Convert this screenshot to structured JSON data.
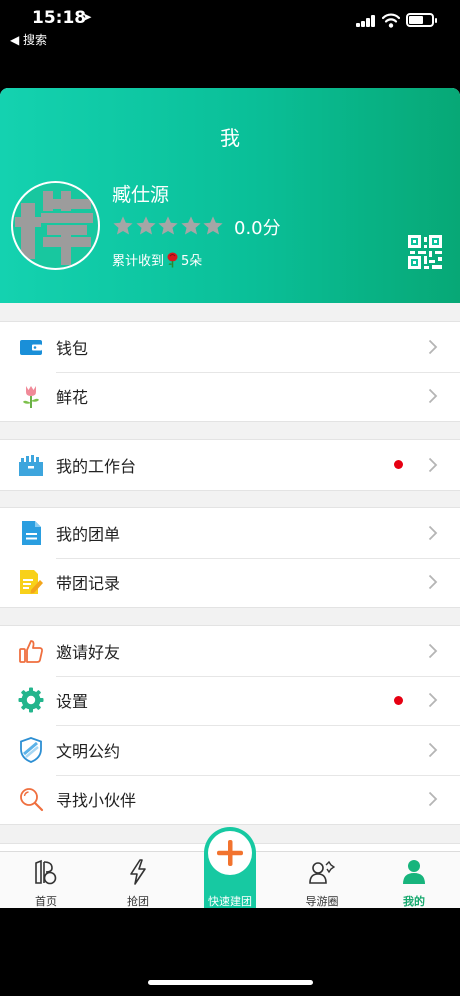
{
  "status_bar": {
    "time": "15:18",
    "back_label": "◀ 搜索"
  },
  "header": {
    "title": "我",
    "avatar_icon": "avatar-placeholder-icon",
    "user_name": "臧仕源",
    "rating": "0.0分",
    "flowers_prefix": "累计收到",
    "flowers_count": "5朵",
    "qr_icon": "qr-code-icon"
  },
  "menu": {
    "wallet": {
      "label": "钱包",
      "icon": "wallet-icon"
    },
    "flowers": {
      "label": "鲜花",
      "icon": "flower-icon"
    },
    "workbench": {
      "label": "我的工作台",
      "icon": "workbench-icon"
    },
    "my_group_orders": {
      "label": "我的团单",
      "icon": "document-icon"
    },
    "tour_records": {
      "label": "带团记录",
      "icon": "edit-note-icon"
    },
    "invite_friends": {
      "label": "邀请好友",
      "icon": "thumbs-up-icon"
    },
    "settings": {
      "label": "设置",
      "icon": "gear-icon"
    },
    "civility_pledge": {
      "label": "文明公约",
      "icon": "shield-icon"
    },
    "find_partners": {
      "label": "寻找小伙伴",
      "icon": "search-icon"
    }
  },
  "tabs": {
    "home": "首页",
    "grab": "抢团",
    "quick_create": "快速建团",
    "guide_circle": "导游圈",
    "mine": "我的"
  },
  "colors": {
    "accent": "#17c9a2",
    "active_tab": "#17a86e",
    "badge_red": "#e60012",
    "quick_create_plus": "#f2732e"
  }
}
